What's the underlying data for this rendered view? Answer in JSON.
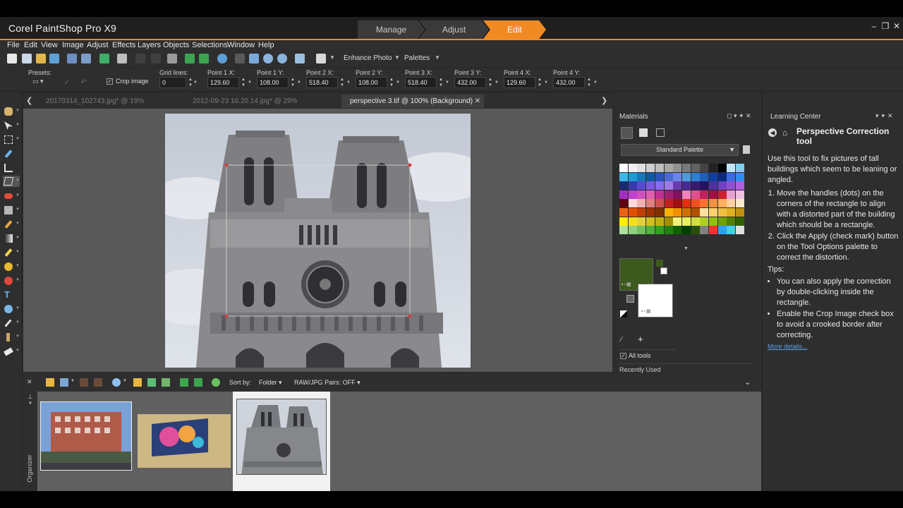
{
  "app": {
    "title": "Corel PaintShop Pro X9",
    "workspace_tabs": [
      "Manage",
      "Adjust",
      "Edit"
    ],
    "active_workspace": "Edit",
    "accent_color": "#f28a24"
  },
  "menu": [
    "File",
    "Edit",
    "View",
    "Image",
    "Adjust",
    "Effects",
    "Layers",
    "Objects",
    "Selections",
    "Window",
    "Help"
  ],
  "standard_toolbar": {
    "enhance_photo": "Enhance Photo",
    "palettes": "Palettes"
  },
  "tool_options": {
    "presets_label": "Presets:",
    "crop_image_label": "Crop image",
    "crop_image_checked": true,
    "grid_lines_label": "Grid lines:",
    "grid_lines_value": "0",
    "points": [
      {
        "label": "Point 1 X:",
        "value": "129.60"
      },
      {
        "label": "Point 1 Y:",
        "value": "108.00"
      },
      {
        "label": "Point 2 X:",
        "value": "518.40"
      },
      {
        "label": "Point 2 Y:",
        "value": "108.00"
      },
      {
        "label": "Point 3 X:",
        "value": "518.40"
      },
      {
        "label": "Point 3 Y:",
        "value": "432.00"
      },
      {
        "label": "Point 4 X:",
        "value": "129.60"
      },
      {
        "label": "Point 4 Y:",
        "value": "432.00"
      }
    ]
  },
  "document_tabs": [
    {
      "label": "20170314_102743.jpg* @ 19% (Background)",
      "active": false
    },
    {
      "label": "2012-09-23 16.20.14.jpg* @ 29% (Background)",
      "active": false
    },
    {
      "label": "perspective 3.tif @ 100% (Background)",
      "active": true
    }
  ],
  "materials": {
    "title": "Materials",
    "palette_name": "Standard Palette",
    "foreground_color": "#3d5a1e",
    "background_color": "#ffffff",
    "all_tools_label": "All tools",
    "all_tools_checked": true,
    "recently_used_label": "Recently Used",
    "recent_colors": [
      "#1a1a1a",
      "#ffffff",
      "#e8401c",
      "#2aa8d8",
      "#5fd0f0",
      "#111111"
    ]
  },
  "learning_center": {
    "title": "Learning Center",
    "heading": "Perspective Correction tool",
    "intro": "Use this tool to fix pictures of tall buildings which seem to be leaning or angled.",
    "steps": [
      "Move the handles (dots) on the corners of the rectangle to align with a distorted part of the building which should be a rectangle.",
      "Click the Apply (check mark) button on the Tool Options palette to correct the distortion."
    ],
    "tips_label": "Tips:",
    "tips": [
      "You can also apply the correction by double-clicking inside the rectangle.",
      "Enable the Crop Image check box to avoid a crooked border after correcting."
    ],
    "more_details": "More details..."
  },
  "organizer": {
    "sort_by_label": "Sort by:",
    "sort_by_value": "Folder",
    "raw_pairs": "RAW/JPG Pairs: OFF",
    "side_label": "Organizer",
    "thumbnails": [
      "street-building",
      "painting-wall",
      "notre-dame"
    ],
    "selected_thumbnail": "notre-dame"
  }
}
